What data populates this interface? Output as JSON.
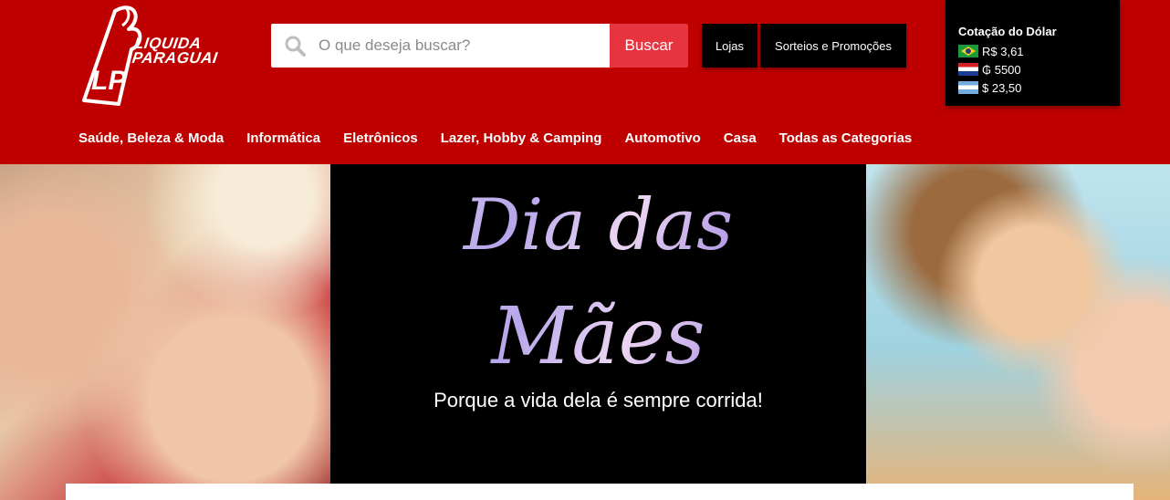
{
  "logo": {
    "line1": "LIQUIDA",
    "line2": "PARAGUAI",
    "mark": "LP",
    "icon": "flame-logo-icon"
  },
  "search": {
    "placeholder": "O que deseja buscar?",
    "value": "",
    "button_label": "Buscar",
    "icon": "search-icon"
  },
  "top_buttons": {
    "lojas": "Lojas",
    "sorteios": "Sorteios e Promoções"
  },
  "dolar": {
    "title": "Cotação do Dólar",
    "rates": [
      {
        "flag": "brazil-flag-icon",
        "value": "R$ 3,61"
      },
      {
        "flag": "paraguay-flag-icon",
        "value": "₲ 5500"
      },
      {
        "flag": "argentina-flag-icon",
        "value": "$ 23,50"
      }
    ]
  },
  "nav": {
    "items": [
      "Saúde, Beleza & Moda",
      "Informática",
      "Eletrônicos",
      "Lazer, Hobby & Camping",
      "Automotivo",
      "Casa",
      "Todas as Categorias"
    ]
  },
  "banner": {
    "title_line1": "Dia das",
    "title_line2": "Mães",
    "tagline": "Porque a vida dela é sempre corrida!"
  },
  "colors": {
    "header_bg": "#bf0000",
    "search_button": "#e8343f",
    "dark": "#000000"
  }
}
